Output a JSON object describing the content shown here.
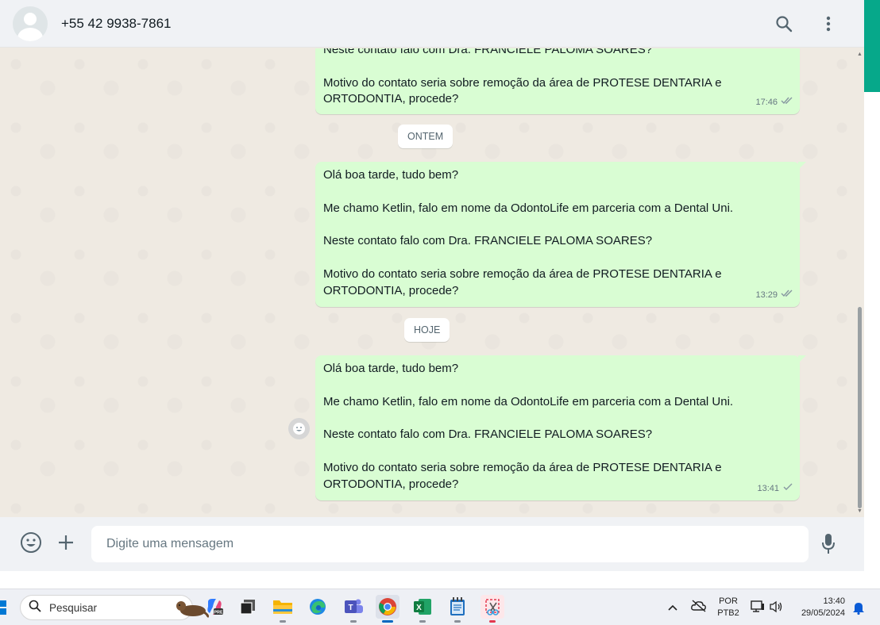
{
  "header": {
    "contact_name": "+55 42 9938-7861",
    "icons": [
      "search-icon",
      "menu-dots-icon"
    ]
  },
  "messages": [
    {
      "paragraphs": [
        "Neste contato falo com Dra. FRANCIELE PALOMA SOARES?",
        "Motivo do contato seria sobre remoção da área de PROTESE DENTARIA e ORTODONTIA, procede?"
      ],
      "time": "17:46",
      "status": "read"
    },
    {
      "date_chip": "ONTEM",
      "paragraphs": [
        "Olá boa tarde, tudo bem?",
        "Me chamo Ketlin, falo em nome da OdontoLife em parceria com a Dental Uni.",
        "Neste contato falo com Dra. FRANCIELE PALOMA SOARES?",
        "Motivo do contato seria sobre remoção da área de PROTESE DENTARIA e ORTODONTIA, procede?"
      ],
      "time": "13:29",
      "status": "read"
    },
    {
      "date_chip": "HOJE",
      "paragraphs": [
        "Olá boa tarde, tudo bem?",
        "Me chamo Ketlin, falo em nome da OdontoLife em parceria com a Dental Uni.",
        "Neste contato falo com Dra. FRANCIELE PALOMA SOARES?",
        "Motivo do contato seria sobre remoção da área de PROTESE DENTARIA e ORTODONTIA, procede?"
      ],
      "time": "13:41",
      "status": "sent"
    }
  ],
  "composer": {
    "placeholder": "Digite uma mensagem"
  },
  "taskbar": {
    "search_label": "Pesquisar",
    "lang_top": "POR",
    "lang_bottom": "PTB2",
    "time": "13:40",
    "date": "29/05/2024",
    "apps": [
      "copilot",
      "task-view",
      "file-explorer",
      "edge",
      "teams",
      "chrome",
      "excel",
      "notepad",
      "snipping-tool"
    ]
  },
  "colors": {
    "outgoing_bubble": "#d9fdd3",
    "chat_bg": "#efeae2",
    "accent": "#06a88a",
    "read_ticks": "#667781"
  }
}
